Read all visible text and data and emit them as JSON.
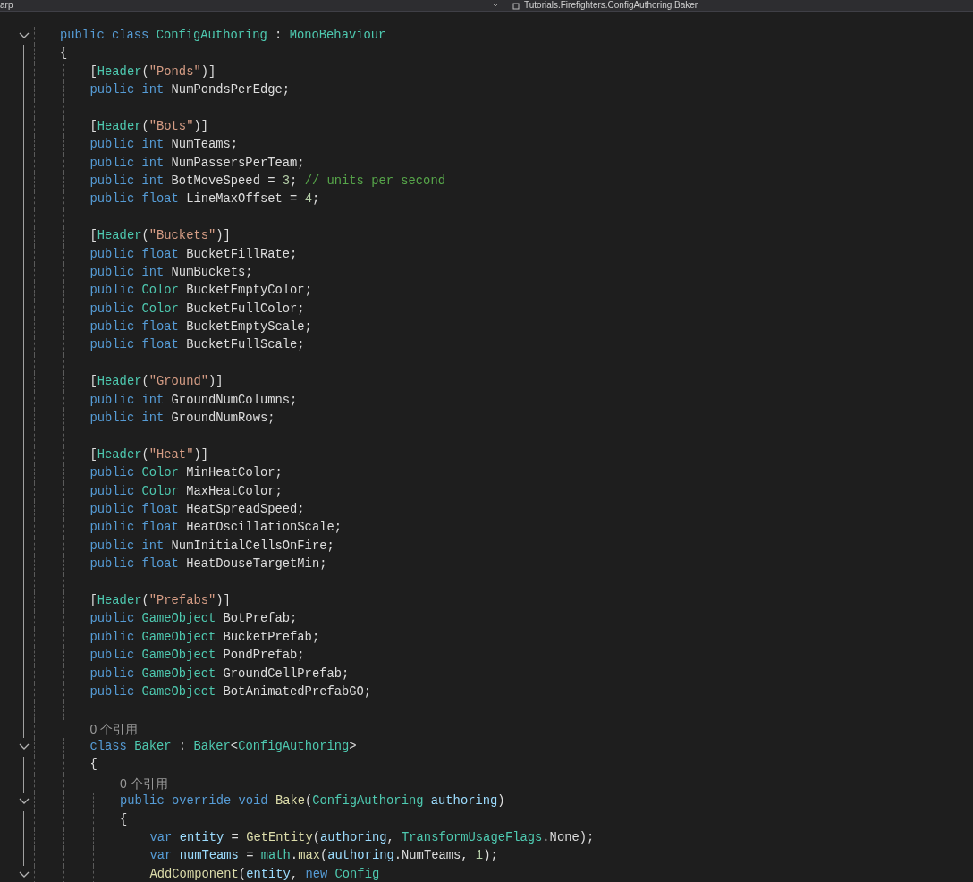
{
  "top_bar": {
    "project": "arp",
    "breadcrumb": "Tutorials.Firefighters.ConfigAuthoring.Baker"
  },
  "lines": [
    {
      "fold": true,
      "tokens": [
        {
          "kind": "kw",
          "text": "public class "
        },
        {
          "kind": "type",
          "text": "ConfigAuthoring"
        },
        {
          "kind": "plain",
          "text": " : "
        },
        {
          "kind": "type",
          "text": "MonoBehaviour"
        }
      ]
    },
    {
      "tokens": [
        {
          "kind": "plain",
          "text": "{"
        }
      ],
      "children": [
        {
          "tokens": [
            {
              "kind": "plain",
              "text": "["
            },
            {
              "kind": "type",
              "text": "Header"
            },
            {
              "kind": "plain",
              "text": "("
            },
            {
              "kind": "str",
              "text": "\"Ponds\""
            },
            {
              "kind": "plain",
              "text": ")]"
            }
          ]
        },
        {
          "tokens": [
            {
              "kind": "kw",
              "text": "public int "
            },
            {
              "kind": "plain",
              "text": "NumPondsPerEdge;"
            }
          ]
        },
        {
          "kind": "blank"
        },
        {
          "tokens": [
            {
              "kind": "plain",
              "text": "["
            },
            {
              "kind": "type",
              "text": "Header"
            },
            {
              "kind": "plain",
              "text": "("
            },
            {
              "kind": "str",
              "text": "\"Bots\""
            },
            {
              "kind": "plain",
              "text": ")]"
            }
          ]
        },
        {
          "tokens": [
            {
              "kind": "kw",
              "text": "public int "
            },
            {
              "kind": "plain",
              "text": "NumTeams;"
            }
          ]
        },
        {
          "tokens": [
            {
              "kind": "kw",
              "text": "public int "
            },
            {
              "kind": "plain",
              "text": "NumPassersPerTeam;"
            }
          ]
        },
        {
          "tokens": [
            {
              "kind": "kw",
              "text": "public int "
            },
            {
              "kind": "plain",
              "text": "BotMoveSpeed = "
            },
            {
              "kind": "num",
              "text": "3"
            },
            {
              "kind": "plain",
              "text": "; "
            },
            {
              "kind": "comment",
              "text": "// units per second"
            }
          ]
        },
        {
          "tokens": [
            {
              "kind": "kw",
              "text": "public float "
            },
            {
              "kind": "plain",
              "text": "LineMaxOffset = "
            },
            {
              "kind": "num",
              "text": "4"
            },
            {
              "kind": "plain",
              "text": ";"
            }
          ]
        },
        {
          "kind": "blank"
        },
        {
          "tokens": [
            {
              "kind": "plain",
              "text": "["
            },
            {
              "kind": "type",
              "text": "Header"
            },
            {
              "kind": "plain",
              "text": "("
            },
            {
              "kind": "str",
              "text": "\"Buckets\""
            },
            {
              "kind": "plain",
              "text": ")]"
            }
          ]
        },
        {
          "tokens": [
            {
              "kind": "kw",
              "text": "public float "
            },
            {
              "kind": "plain",
              "text": "BucketFillRate;"
            }
          ]
        },
        {
          "tokens": [
            {
              "kind": "kw",
              "text": "public int "
            },
            {
              "kind": "plain",
              "text": "NumBuckets;"
            }
          ]
        },
        {
          "tokens": [
            {
              "kind": "kw",
              "text": "public "
            },
            {
              "kind": "type",
              "text": "Color"
            },
            {
              "kind": "plain",
              "text": " BucketEmptyColor;"
            }
          ]
        },
        {
          "tokens": [
            {
              "kind": "kw",
              "text": "public "
            },
            {
              "kind": "type",
              "text": "Color"
            },
            {
              "kind": "plain",
              "text": " BucketFullColor;"
            }
          ]
        },
        {
          "tokens": [
            {
              "kind": "kw",
              "text": "public float "
            },
            {
              "kind": "plain",
              "text": "BucketEmptyScale;"
            }
          ]
        },
        {
          "tokens": [
            {
              "kind": "kw",
              "text": "public float "
            },
            {
              "kind": "plain",
              "text": "BucketFullScale;"
            }
          ]
        },
        {
          "kind": "blank"
        },
        {
          "tokens": [
            {
              "kind": "plain",
              "text": "["
            },
            {
              "kind": "type",
              "text": "Header"
            },
            {
              "kind": "plain",
              "text": "("
            },
            {
              "kind": "str",
              "text": "\"Ground\""
            },
            {
              "kind": "plain",
              "text": ")]"
            }
          ]
        },
        {
          "tokens": [
            {
              "kind": "kw",
              "text": "public int "
            },
            {
              "kind": "plain",
              "text": "GroundNumColumns;"
            }
          ]
        },
        {
          "tokens": [
            {
              "kind": "kw",
              "text": "public int "
            },
            {
              "kind": "plain",
              "text": "GroundNumRows;"
            }
          ]
        },
        {
          "kind": "blank"
        },
        {
          "tokens": [
            {
              "kind": "plain",
              "text": "["
            },
            {
              "kind": "type",
              "text": "Header"
            },
            {
              "kind": "plain",
              "text": "("
            },
            {
              "kind": "str",
              "text": "\"Heat\""
            },
            {
              "kind": "plain",
              "text": ")]"
            }
          ]
        },
        {
          "tokens": [
            {
              "kind": "kw",
              "text": "public "
            },
            {
              "kind": "type",
              "text": "Color"
            },
            {
              "kind": "plain",
              "text": " MinHeatColor;"
            }
          ]
        },
        {
          "tokens": [
            {
              "kind": "kw",
              "text": "public "
            },
            {
              "kind": "type",
              "text": "Color"
            },
            {
              "kind": "plain",
              "text": " MaxHeatColor;"
            }
          ]
        },
        {
          "tokens": [
            {
              "kind": "kw",
              "text": "public float "
            },
            {
              "kind": "plain",
              "text": "HeatSpreadSpeed;"
            }
          ]
        },
        {
          "tokens": [
            {
              "kind": "kw",
              "text": "public float "
            },
            {
              "kind": "plain",
              "text": "HeatOscillationScale;"
            }
          ]
        },
        {
          "tokens": [
            {
              "kind": "kw",
              "text": "public int "
            },
            {
              "kind": "plain",
              "text": "NumInitialCellsOnFire;"
            }
          ]
        },
        {
          "tokens": [
            {
              "kind": "kw",
              "text": "public float "
            },
            {
              "kind": "plain",
              "text": "HeatDouseTargetMin;"
            }
          ]
        },
        {
          "kind": "blank"
        },
        {
          "tokens": [
            {
              "kind": "plain",
              "text": "["
            },
            {
              "kind": "type",
              "text": "Header"
            },
            {
              "kind": "plain",
              "text": "("
            },
            {
              "kind": "str",
              "text": "\"Prefabs\""
            },
            {
              "kind": "plain",
              "text": ")]"
            }
          ]
        },
        {
          "tokens": [
            {
              "kind": "kw",
              "text": "public "
            },
            {
              "kind": "type",
              "text": "GameObject"
            },
            {
              "kind": "plain",
              "text": " BotPrefab;"
            }
          ]
        },
        {
          "tokens": [
            {
              "kind": "kw",
              "text": "public "
            },
            {
              "kind": "type",
              "text": "GameObject"
            },
            {
              "kind": "plain",
              "text": " BucketPrefab;"
            }
          ]
        },
        {
          "tokens": [
            {
              "kind": "kw",
              "text": "public "
            },
            {
              "kind": "type",
              "text": "GameObject"
            },
            {
              "kind": "plain",
              "text": " PondPrefab;"
            }
          ]
        },
        {
          "tokens": [
            {
              "kind": "kw",
              "text": "public "
            },
            {
              "kind": "type",
              "text": "GameObject"
            },
            {
              "kind": "plain",
              "text": " GroundCellPrefab;"
            }
          ]
        },
        {
          "tokens": [
            {
              "kind": "kw",
              "text": "public "
            },
            {
              "kind": "type",
              "text": "GameObject"
            },
            {
              "kind": "plain",
              "text": " BotAnimatedPrefabGO;"
            }
          ]
        },
        {
          "kind": "blank"
        },
        {
          "kind": "codelens",
          "text": "0 个引用"
        },
        {
          "fold": true,
          "tokens": [
            {
              "kind": "kw",
              "text": "class "
            },
            {
              "kind": "type",
              "text": "Baker"
            },
            {
              "kind": "plain",
              "text": " : "
            },
            {
              "kind": "type",
              "text": "Baker"
            },
            {
              "kind": "plain",
              "text": "<"
            },
            {
              "kind": "type",
              "text": "ConfigAuthoring"
            },
            {
              "kind": "plain",
              "text": ">"
            }
          ]
        },
        {
          "tokens": [
            {
              "kind": "plain",
              "text": "{"
            }
          ],
          "children": [
            {
              "kind": "codelens",
              "text": "0 个引用"
            },
            {
              "fold": true,
              "tokens": [
                {
                  "kind": "kw",
                  "text": "public override void "
                },
                {
                  "kind": "method",
                  "text": "Bake"
                },
                {
                  "kind": "plain",
                  "text": "("
                },
                {
                  "kind": "type",
                  "text": "ConfigAuthoring"
                },
                {
                  "kind": "param",
                  "text": " authoring"
                },
                {
                  "kind": "plain",
                  "text": ")"
                }
              ]
            },
            {
              "tokens": [
                {
                  "kind": "plain",
                  "text": "{"
                }
              ],
              "children": [
                {
                  "tokens": [
                    {
                      "kind": "kw",
                      "text": "var "
                    },
                    {
                      "kind": "param",
                      "text": "entity"
                    },
                    {
                      "kind": "plain",
                      "text": " = "
                    },
                    {
                      "kind": "method",
                      "text": "GetEntity"
                    },
                    {
                      "kind": "plain",
                      "text": "("
                    },
                    {
                      "kind": "param",
                      "text": "authoring"
                    },
                    {
                      "kind": "plain",
                      "text": ", "
                    },
                    {
                      "kind": "type",
                      "text": "TransformUsageFlags"
                    },
                    {
                      "kind": "plain",
                      "text": ".None);"
                    }
                  ]
                },
                {
                  "tokens": [
                    {
                      "kind": "kw",
                      "text": "var "
                    },
                    {
                      "kind": "param",
                      "text": "numTeams"
                    },
                    {
                      "kind": "plain",
                      "text": " = "
                    },
                    {
                      "kind": "type",
                      "text": "math"
                    },
                    {
                      "kind": "plain",
                      "text": "."
                    },
                    {
                      "kind": "method",
                      "text": "max"
                    },
                    {
                      "kind": "plain",
                      "text": "("
                    },
                    {
                      "kind": "param",
                      "text": "authoring"
                    },
                    {
                      "kind": "plain",
                      "text": ".NumTeams, "
                    },
                    {
                      "kind": "num",
                      "text": "1"
                    },
                    {
                      "kind": "plain",
                      "text": ");"
                    }
                  ]
                },
                {
                  "fold": true,
                  "tokens": [
                    {
                      "kind": "method",
                      "text": "AddComponent"
                    },
                    {
                      "kind": "plain",
                      "text": "("
                    },
                    {
                      "kind": "param",
                      "text": "entity"
                    },
                    {
                      "kind": "plain",
                      "text": ", "
                    },
                    {
                      "kind": "kw",
                      "text": "new "
                    },
                    {
                      "kind": "type",
                      "text": "Config"
                    }
                  ]
                }
              ]
            }
          ]
        }
      ]
    }
  ]
}
